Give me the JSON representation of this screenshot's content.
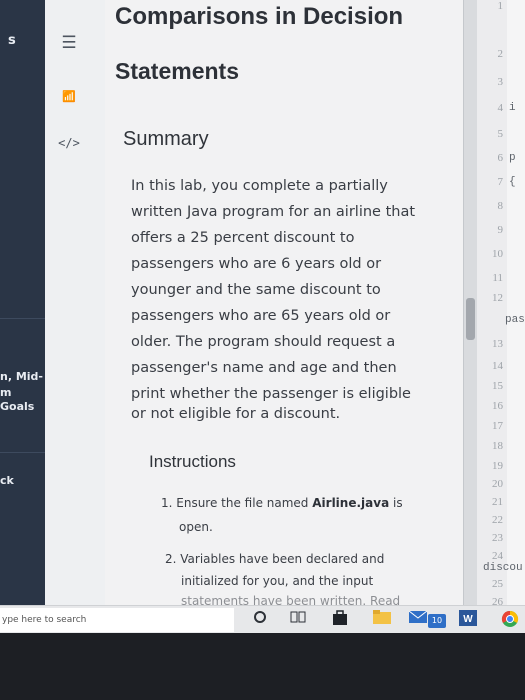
{
  "left_strip": {
    "top_letter": "s",
    "goals_line1": "n, Mid-",
    "goals_line2": "m Goals",
    "back_text": "ck"
  },
  "rail_icons": [
    "list-icon",
    "chart-icon",
    "code-icon",
    "share-icon",
    "help-icon",
    "settings-icon"
  ],
  "rail": {
    "list_glyph": "☰",
    "chart_glyph": "📶",
    "code_glyph": "</>",
    "share_glyph": "⚯",
    "help_glyph": "?",
    "settings_glyph": "⚙"
  },
  "lab": {
    "title_line1": "Comparisons in Decision",
    "title_line2": "Statements",
    "summary_heading": "Summary",
    "summary_lines": [
      "In this lab, you complete a partially",
      "written Java program for an airline that",
      "offers a 25 percent discount to",
      "passengers who are 6 years old or",
      "younger and the same discount to",
      "passengers who are 65 years old or",
      "older. The program should request a",
      "passenger's name and age and then",
      "print whether the passenger is eligible",
      "or not eligible for a discount."
    ],
    "instructions_heading": "Instructions",
    "step1_prefix": "1. Ensure the file named ",
    "step1_file": "Airline.java",
    "step1_suffix": " is",
    "step1_line2": "open.",
    "step2_line1": "2. Variables have been declared and",
    "step2_line2": "initialized for you, and the input",
    "step2_line3": "statements have been written. Read"
  },
  "line_numbers": [
    "1",
    "2",
    "3",
    "4",
    "5",
    "6",
    "7",
    "8",
    "9",
    "10",
    "11",
    "12",
    "13",
    "14",
    "15",
    "16",
    "17",
    "18",
    "19",
    "20",
    "21",
    "22",
    "23",
    "24",
    "25",
    "26"
  ],
  "code_edge": {
    "line4": "i",
    "line6": "p",
    "line7": "{",
    "line12": "pas",
    "line24": "discou"
  },
  "taskbar": {
    "search_placeholder": "ype here to search",
    "badge_count": "10"
  },
  "colors": {
    "left_dark": "#2a3546",
    "content_bg": "#f2f2f3",
    "text": "#3a3e45"
  }
}
